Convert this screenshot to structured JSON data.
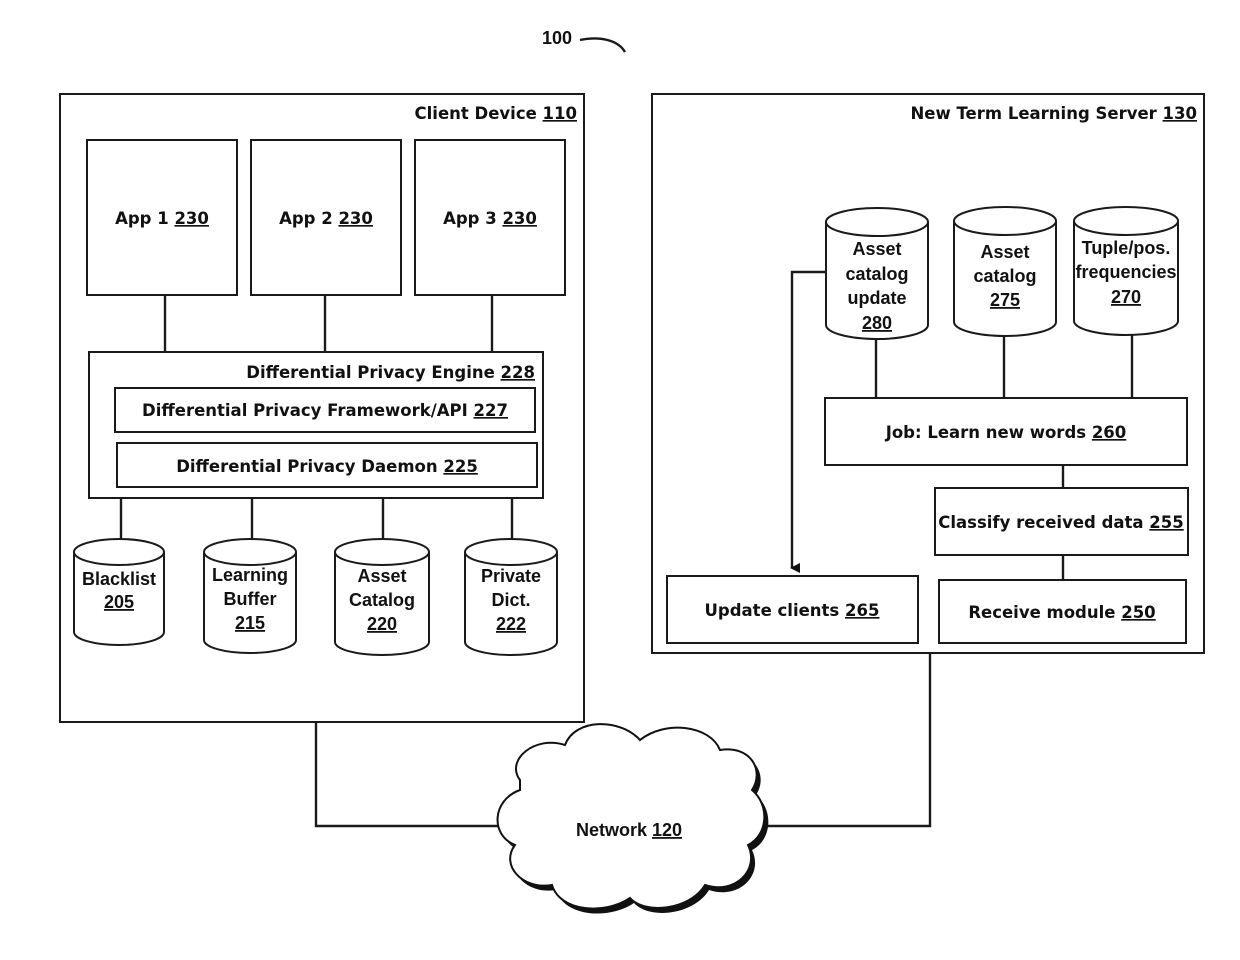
{
  "figure": {
    "ref": "100"
  },
  "client_device": {
    "title": "Client Device",
    "ref": "110",
    "apps": [
      {
        "label": "App 1",
        "ref": "230"
      },
      {
        "label": "App 2",
        "ref": "230"
      },
      {
        "label": "App 3",
        "ref": "230"
      }
    ],
    "dp_engine": {
      "title": "Differential Privacy Engine",
      "ref": "228"
    },
    "dp_framework": {
      "title": "Differential Privacy Framework/API",
      "ref": "227"
    },
    "dp_daemon": {
      "title": "Differential Privacy Daemon",
      "ref": "225"
    },
    "stores": [
      {
        "lines": [
          "Blacklist"
        ],
        "ref": "205"
      },
      {
        "lines": [
          "Learning",
          "Buffer"
        ],
        "ref": "215"
      },
      {
        "lines": [
          "Asset",
          "Catalog"
        ],
        "ref": "220"
      },
      {
        "lines": [
          "Private",
          "Dict."
        ],
        "ref": "222"
      }
    ]
  },
  "server": {
    "title": "New Term Learning Server",
    "ref": "130",
    "stores": [
      {
        "lines": [
          "Asset",
          "catalog",
          "update"
        ],
        "ref": "280"
      },
      {
        "lines": [
          "Asset",
          "catalog"
        ],
        "ref": "275"
      },
      {
        "lines": [
          "Tuple/pos.",
          "frequencies"
        ],
        "ref": "270"
      }
    ],
    "job": {
      "title": "Job: Learn new words",
      "ref": "260"
    },
    "classify": {
      "title": "Classify received data",
      "ref": "255"
    },
    "update_clients": {
      "title": "Update clients",
      "ref": "265"
    },
    "receive": {
      "title": "Receive module",
      "ref": "250"
    }
  },
  "network": {
    "title": "Network",
    "ref": "120"
  }
}
